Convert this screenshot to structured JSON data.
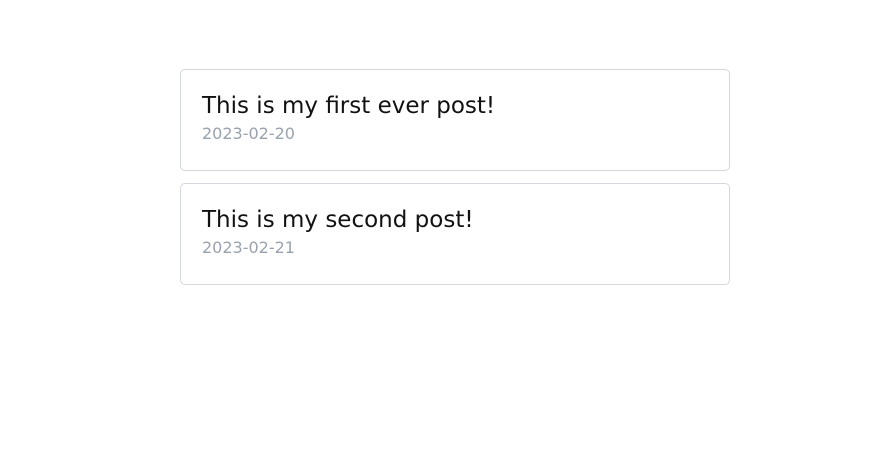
{
  "posts": [
    {
      "title": "This is my first ever post!",
      "date": "2023-02-20"
    },
    {
      "title": "This is my second post!",
      "date": "2023-02-21"
    }
  ]
}
